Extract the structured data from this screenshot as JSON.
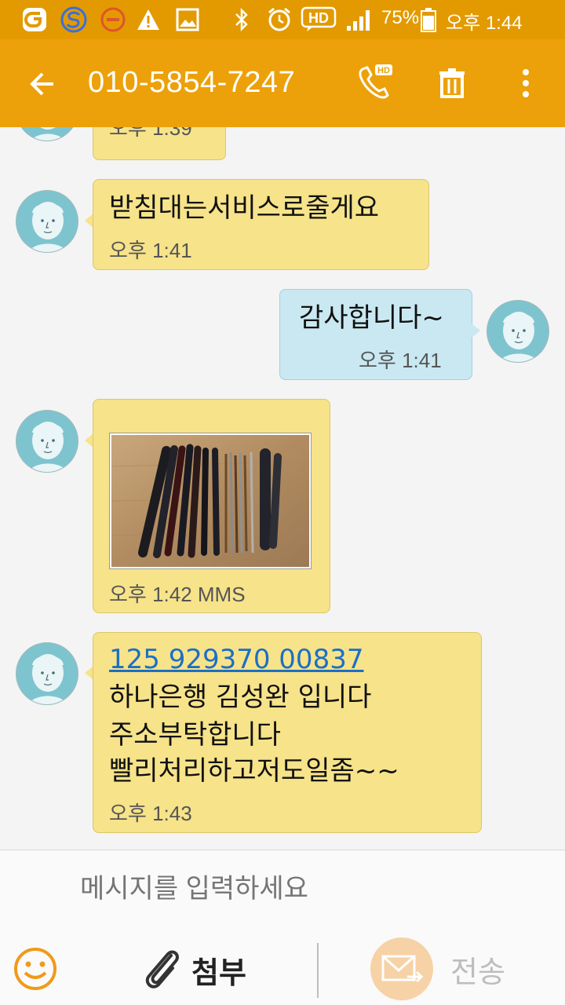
{
  "status_bar": {
    "battery": "75%",
    "time": "오후 1:44",
    "icons": [
      "o-logo-icon",
      "s-logo-icon",
      "blocked-icon",
      "warning-icon",
      "image-icon",
      "bluetooth-icon",
      "alarm-icon",
      "hd-voice-icon",
      "signal-icon",
      "battery-icon"
    ],
    "hd_label": "HD"
  },
  "app_bar": {
    "title": "010-5854-7247",
    "call_badge": "HD",
    "icons": [
      "back-arrow-icon",
      "hd-call-icon",
      "trash-icon",
      "more-vert-icon"
    ]
  },
  "messages": [
    {
      "direction": "incoming",
      "text": "",
      "time": "오후 1:39",
      "partial": true
    },
    {
      "direction": "incoming",
      "text": "받침대는서비스로줄게요",
      "time": "오후 1:41"
    },
    {
      "direction": "outgoing",
      "text": "감사합니다~",
      "time": "오후 1:41"
    },
    {
      "direction": "incoming",
      "type": "mms",
      "image_desc": "fishing rods on wooden floor",
      "time": "오후 1:42 MMS"
    },
    {
      "direction": "incoming",
      "link": "125 929370 00837",
      "lines": [
        "하나은행 김성완 입니다",
        "주소부탁합니다",
        "빨리처리하고저도일좀~~"
      ],
      "time": "오후 1:43"
    }
  ],
  "composer": {
    "placeholder": "메시지를 입력하세요",
    "attach_label": "첨부",
    "send_label": "전송",
    "icons": [
      "emoji-icon",
      "paperclip-icon",
      "send-envelope-icon"
    ]
  },
  "colors": {
    "status_bar": "#e29a00",
    "app_bar": "#eca10a",
    "incoming_bubble": "#f6e38a",
    "outgoing_bubble": "#c9e8f2",
    "link": "#1c6fc4",
    "avatar": "#7ec4cf"
  }
}
